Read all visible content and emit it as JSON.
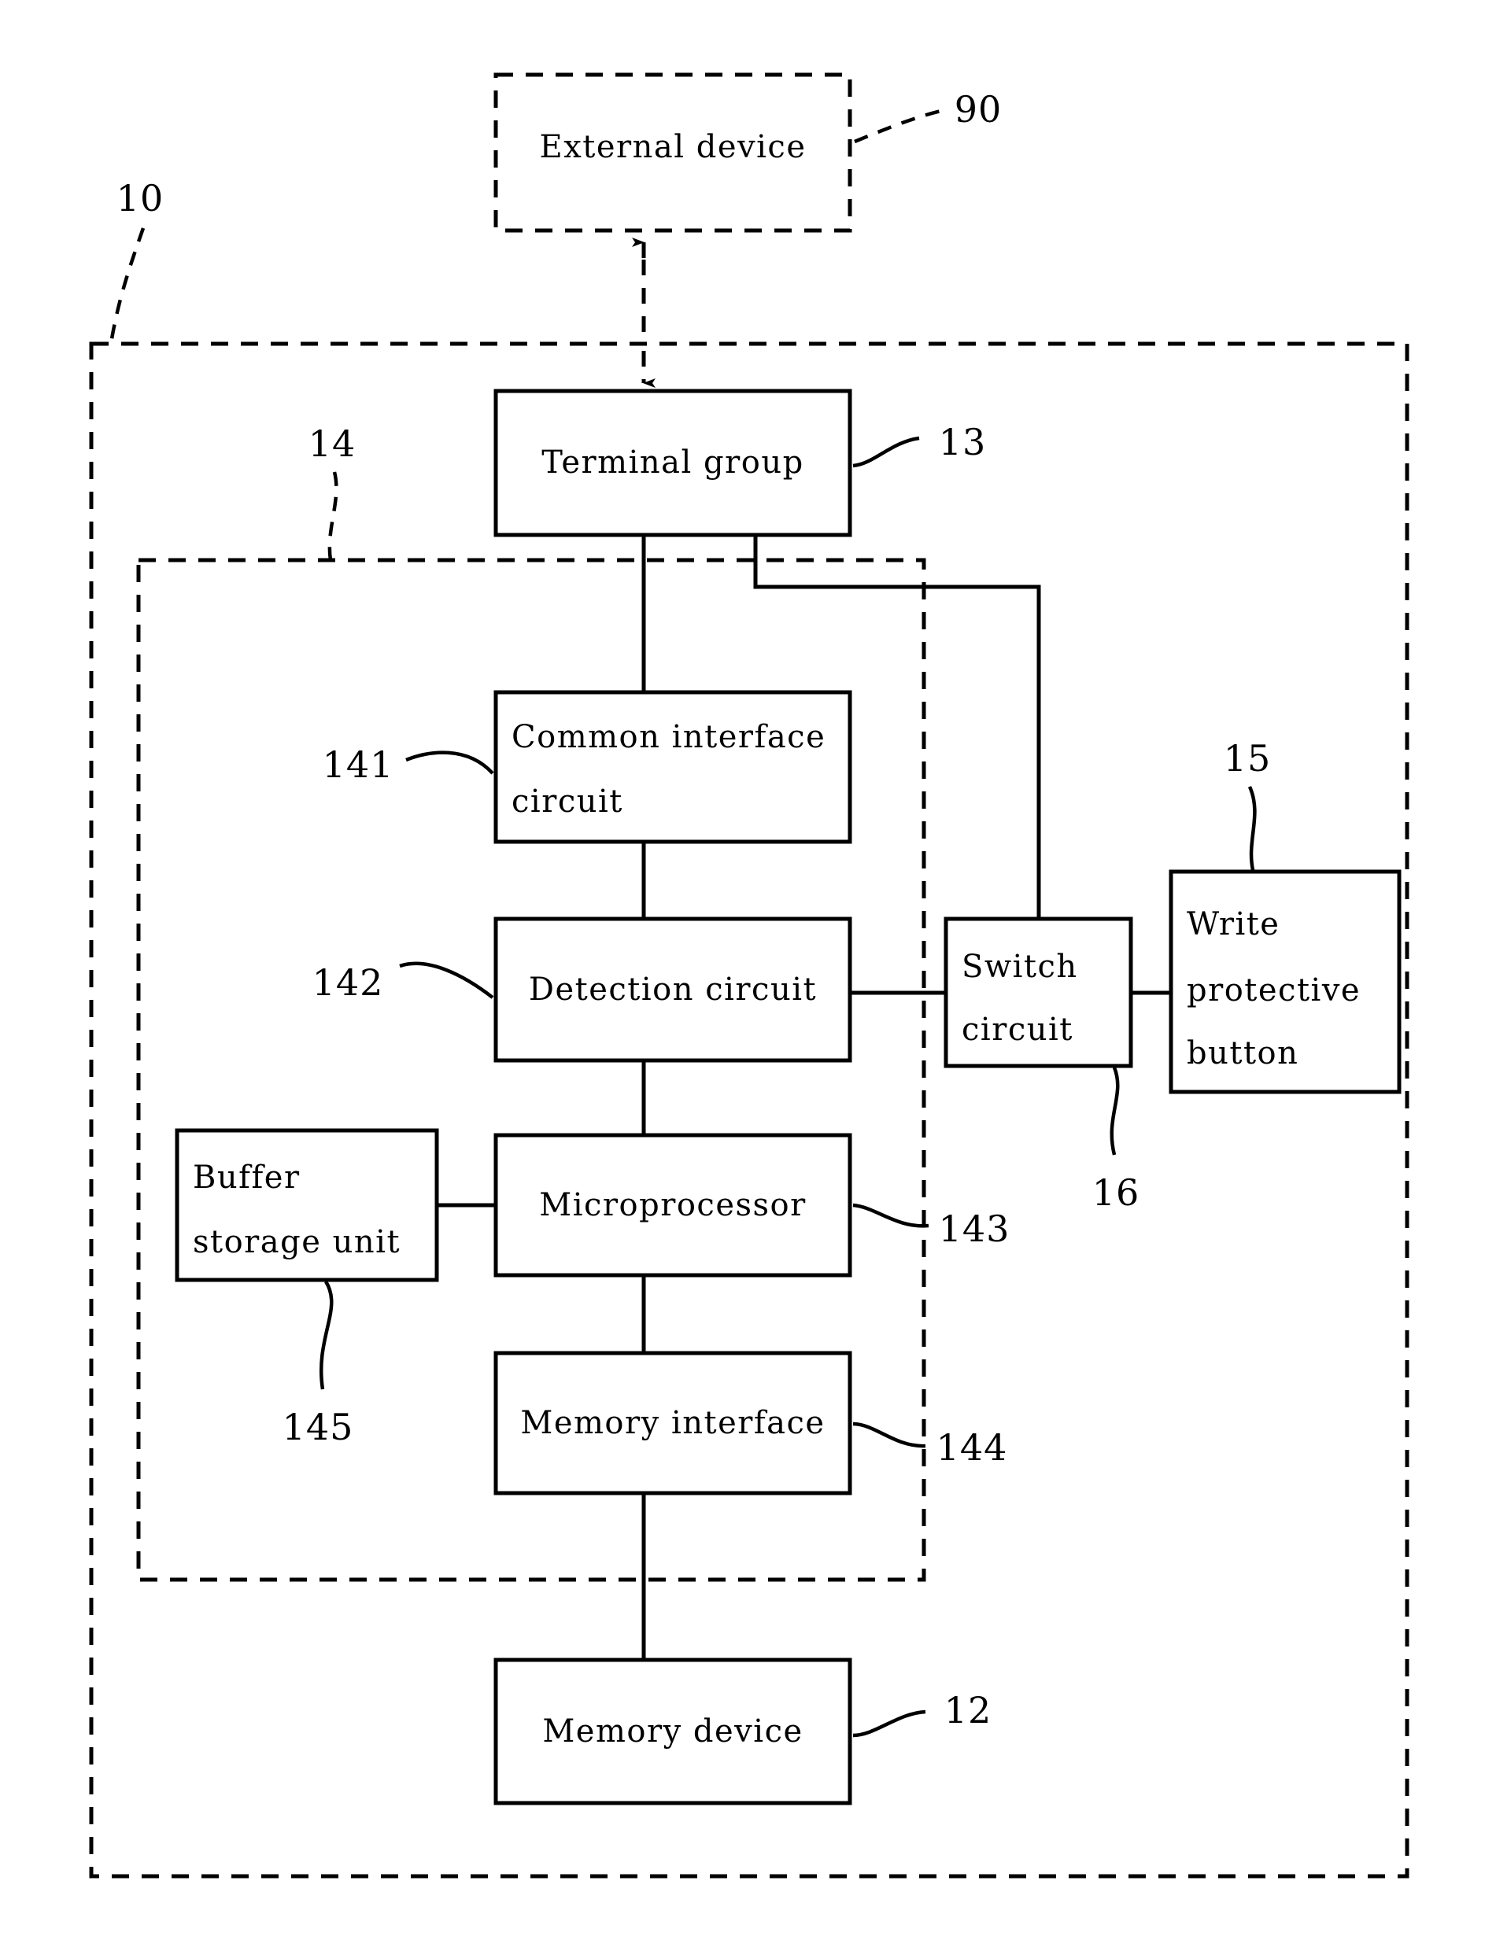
{
  "figure": {
    "type": "patent-block-diagram",
    "title": "Memory device write protection block diagram"
  },
  "blocks": {
    "external_device": {
      "label": "External device",
      "ref": "90",
      "style": "dashed",
      "align": "center"
    },
    "terminal_group": {
      "label": "Terminal group",
      "ref": "13",
      "style": "solid",
      "align": "center"
    },
    "common_interface_circuit": {
      "label_line1": "Common interface",
      "label_line2": "circuit",
      "ref": "141",
      "style": "solid",
      "align": "left"
    },
    "detection_circuit": {
      "label": "Detection circuit",
      "ref": "142",
      "style": "solid",
      "align": "center"
    },
    "microprocessor": {
      "label": "Microprocessor",
      "ref": "143",
      "style": "solid",
      "align": "center"
    },
    "memory_interface": {
      "label": "Memory interface",
      "ref": "144",
      "style": "solid",
      "align": "center"
    },
    "memory_device": {
      "label": "Memory device",
      "ref": "12",
      "style": "solid",
      "align": "center"
    },
    "buffer_storage_unit": {
      "label_line1": "Buffer",
      "label_line2": "storage unit",
      "ref": "145",
      "style": "solid",
      "align": "left"
    },
    "switch_circuit": {
      "label_line1": "Switch",
      "label_line2": "circuit",
      "ref": "16",
      "style": "solid",
      "align": "left"
    },
    "write_protective_button": {
      "label_line1": "Write",
      "label_line2": "protective",
      "label_line3": "button",
      "ref": "15",
      "style": "solid",
      "align": "left"
    }
  },
  "enclosures": {
    "outer_device": {
      "ref": "10",
      "style": "dashed"
    },
    "controller": {
      "ref": "14",
      "style": "dashed"
    }
  },
  "refs": {
    "r10": "10",
    "r90": "90",
    "r13": "13",
    "r14": "14",
    "r141": "141",
    "r142": "142",
    "r143": "143",
    "r144": "144",
    "r145": "145",
    "r12": "12",
    "r15": "15",
    "r16": "16"
  },
  "colors": {
    "stroke": "#000000",
    "background": "#ffffff"
  }
}
